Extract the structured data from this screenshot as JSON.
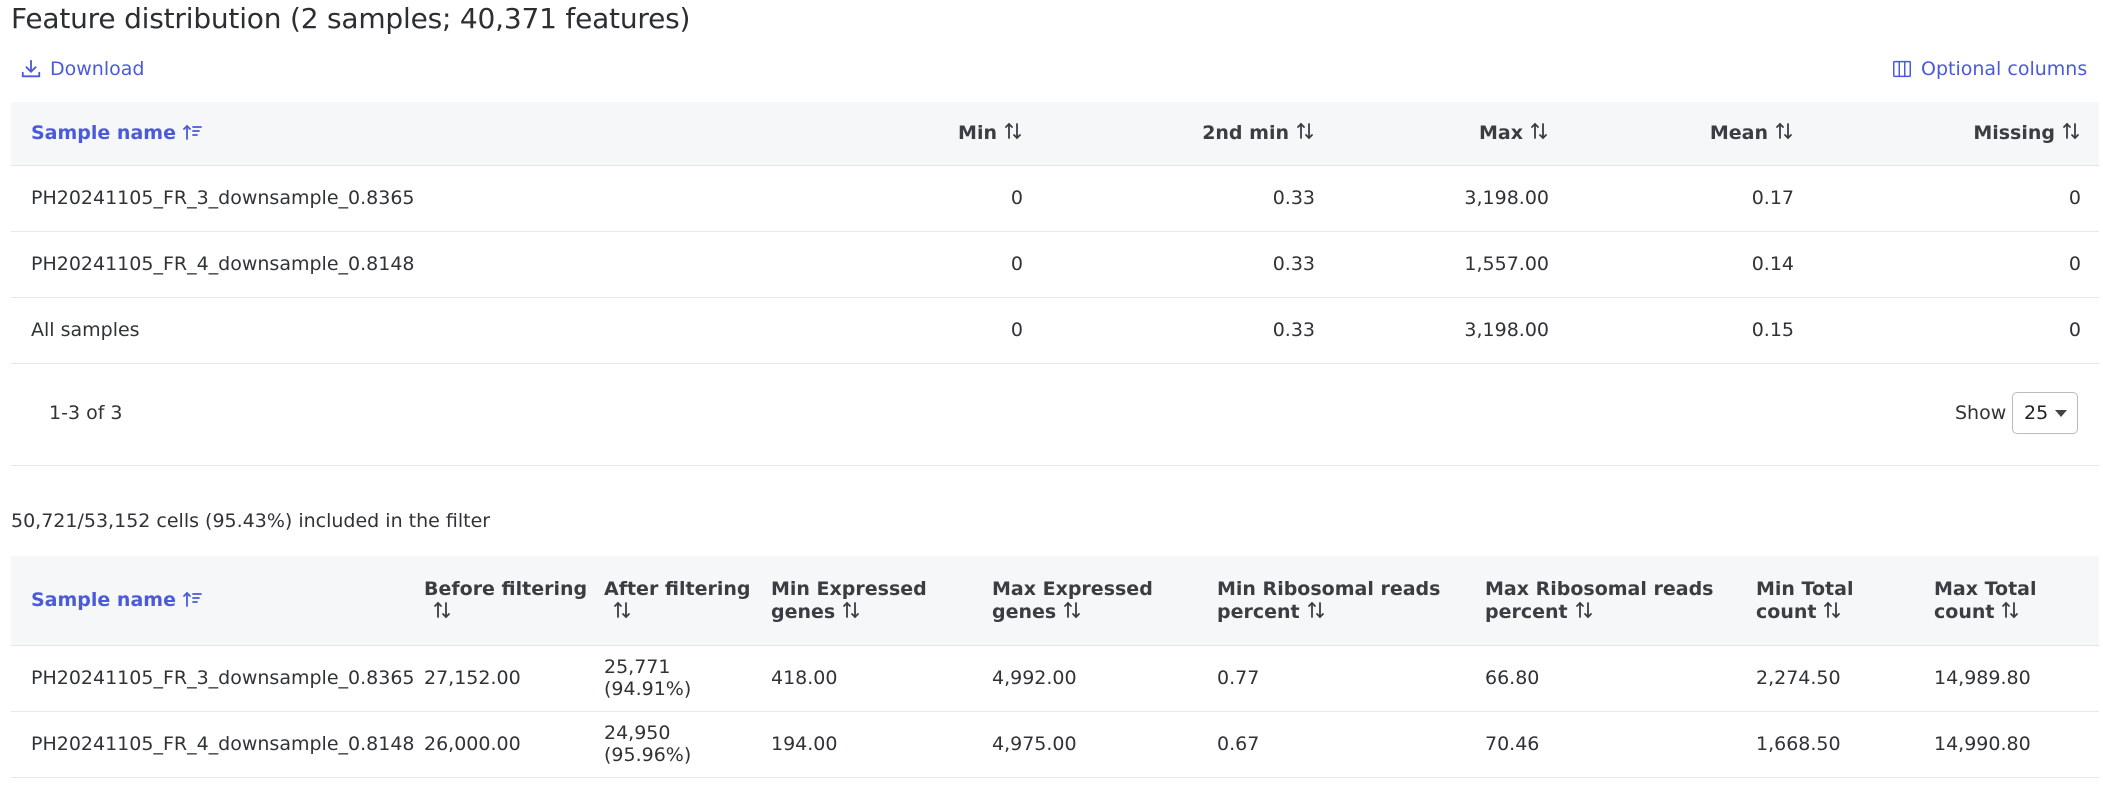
{
  "title": "Feature distribution (2 samples; 40,371 features)",
  "toolbar": {
    "download_label": "Download",
    "optional_columns_label": "Optional columns"
  },
  "feature_table": {
    "headers": {
      "sample_name": "Sample name",
      "min": "Min",
      "second_min": "2nd min",
      "max": "Max",
      "mean": "Mean",
      "missing": "Missing"
    },
    "rows": [
      {
        "sample": "PH20241105_FR_3_downsample_0.8365",
        "min": "0",
        "second_min": "0.33",
        "max": "3,198.00",
        "mean": "0.17",
        "missing": "0"
      },
      {
        "sample": "PH20241105_FR_4_downsample_0.8148",
        "min": "0",
        "second_min": "0.33",
        "max": "1,557.00",
        "mean": "0.14",
        "missing": "0"
      },
      {
        "sample": "All samples",
        "min": "0",
        "second_min": "0.33",
        "max": "3,198.00",
        "mean": "0.15",
        "missing": "0"
      }
    ]
  },
  "pagination": {
    "range": "1-3 of 3",
    "show_label": "Show",
    "page_size": "25"
  },
  "filter_summary": "50,721/53,152 cells (95.43%) included in the filter",
  "filter_table": {
    "headers": {
      "sample_name": "Sample name",
      "before_filtering": "Before filtering",
      "after_filtering": "After filtering",
      "min_expressed_genes_1": "Min Expressed",
      "min_expressed_genes_2": "genes",
      "max_expressed_genes_1": "Max Expressed",
      "max_expressed_genes_2": "genes",
      "min_ribosomal_1": "Min Ribosomal reads",
      "min_ribosomal_2": "percent",
      "max_ribosomal_1": "Max Ribosomal reads",
      "max_ribosomal_2": "percent",
      "min_total_count_1": "Min Total",
      "min_total_count_2": "count",
      "max_total_count_1": "Max Total",
      "max_total_count_2": "count"
    },
    "rows": [
      {
        "sample": "PH20241105_FR_3_downsample_0.8365",
        "before": "27,152.00",
        "after_value": "25,771",
        "after_pct": "(94.91%)",
        "min_genes": "418.00",
        "max_genes": "4,992.00",
        "min_ribo": "0.77",
        "max_ribo": "66.80",
        "min_total": "2,274.50",
        "max_total": "14,989.80"
      },
      {
        "sample": "PH20241105_FR_4_downsample_0.8148",
        "before": "26,000.00",
        "after_value": "24,950",
        "after_pct": "(95.96%)",
        "min_genes": "194.00",
        "max_genes": "4,975.00",
        "min_ribo": "0.67",
        "max_ribo": "70.46",
        "min_total": "1,668.50",
        "max_total": "14,990.80"
      }
    ]
  },
  "colors": {
    "accent": "#4a5ad8",
    "header_bg": "#f6f7f8",
    "row_border": "#e6e8eb"
  }
}
